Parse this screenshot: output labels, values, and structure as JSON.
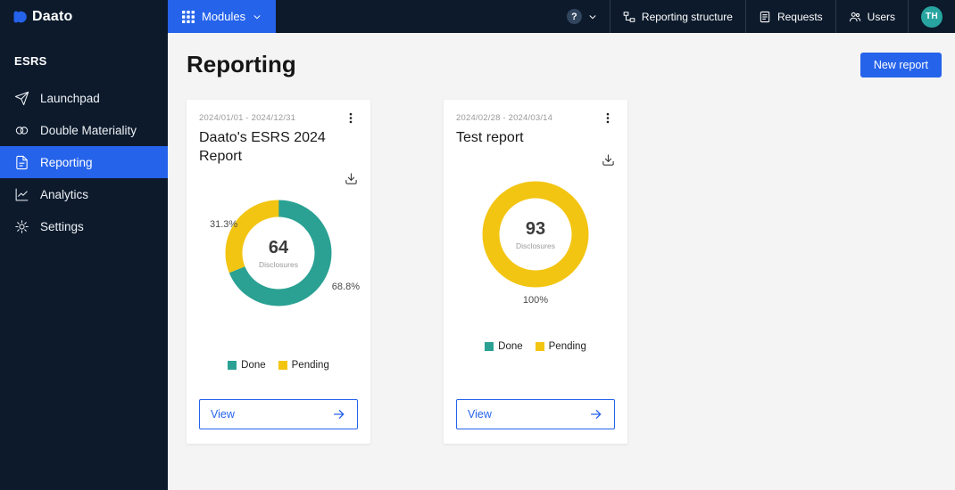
{
  "colors": {
    "accent": "#2563eb",
    "topbar_bg": "#0c1a2c",
    "main_bg": "#f4f4f4",
    "done": "#2aa193",
    "pending": "#f3c513",
    "avatar_bg": "#28a5a0"
  },
  "topbar": {
    "logo": "Daato",
    "modules": "Modules",
    "help": "?",
    "reporting_structure": "Reporting structure",
    "requests": "Requests",
    "users": "Users",
    "avatar": "TH"
  },
  "sidebar": {
    "section": "ESRS",
    "items": [
      {
        "label": "Launchpad",
        "icon": "rocket-icon"
      },
      {
        "label": "Double Materiality",
        "icon": "overlapping-circles-icon"
      },
      {
        "label": "Reporting",
        "icon": "document-icon",
        "active": true
      },
      {
        "label": "Analytics",
        "icon": "line-chart-icon"
      },
      {
        "label": "Settings",
        "icon": "gear-icon"
      }
    ]
  },
  "main": {
    "title": "Reporting",
    "new_report": "New report"
  },
  "legend": {
    "done": "Done",
    "pending": "Pending"
  },
  "cards": [
    {
      "date_range": "2024/01/01 - 2024/12/31",
      "title": "Daato's ESRS 2024 Report",
      "center_value": "64",
      "center_label": "Disclosures",
      "done_pct": 68.8,
      "pending_pct": 31.3,
      "label_left": "31.3%",
      "label_right": "68.8%",
      "view": "View"
    },
    {
      "date_range": "2024/02/28 - 2024/03/14",
      "title": "Test report",
      "center_value": "93",
      "center_label": "Disclosures",
      "done_pct": 0,
      "pending_pct": 100,
      "label_bottom": "100%",
      "view": "View"
    }
  ],
  "chart_data": [
    {
      "type": "pie",
      "title": "Daato's ESRS 2024 Report",
      "series": [
        {
          "name": "Done",
          "value": 68.8
        },
        {
          "name": "Pending",
          "value": 31.3
        }
      ],
      "center_value": 64,
      "center_label": "Disclosures",
      "legend_position": "bottom"
    },
    {
      "type": "pie",
      "title": "Test report",
      "series": [
        {
          "name": "Done",
          "value": 0
        },
        {
          "name": "Pending",
          "value": 100
        }
      ],
      "center_value": 93,
      "center_label": "Disclosures",
      "legend_position": "bottom"
    }
  ]
}
